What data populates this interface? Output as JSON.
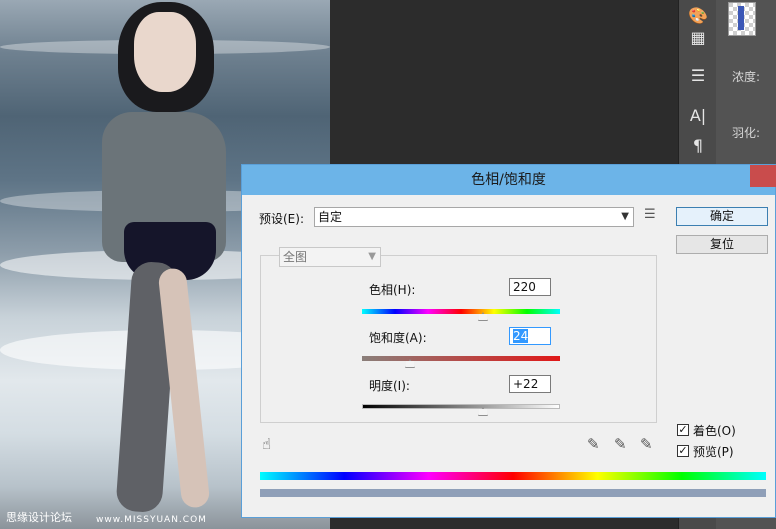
{
  "photo": {
    "watermark": "思缘设计论坛",
    "watermark_url": "www.MISSYUAN.COM"
  },
  "ps": {
    "panel_labels": [
      "浓度:",
      "羽化:"
    ]
  },
  "dialog": {
    "title": "色相/饱和度",
    "preset_label": "预设(E):",
    "preset_value": "自定",
    "ok_label": "确定",
    "reset_label": "复位",
    "channel_value": "全图",
    "hue_label": "色相(H):",
    "hue_value": 220,
    "saturation_label": "饱和度(A):",
    "saturation_value": 24,
    "lightness_label": "明度(I):",
    "lightness_value": "+22",
    "colorize_label": "着色(O)",
    "colorize_checked": true,
    "preview_label": "预览(P)",
    "preview_checked": true,
    "slider_positions": {
      "hue": 0.61,
      "saturation": 0.24,
      "lightness": 0.61
    }
  }
}
